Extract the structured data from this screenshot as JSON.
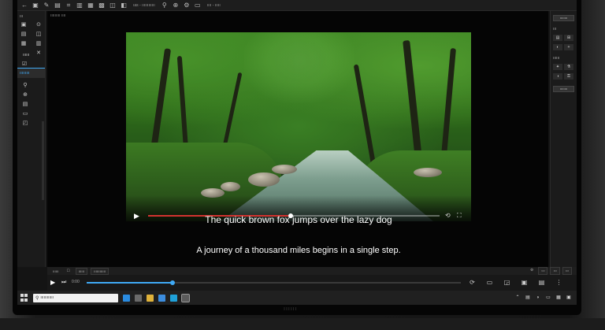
{
  "toolbar": {
    "left_text": "ıas - ıııııııııııı",
    "right_text": "ıııı - ııııı"
  },
  "left_panel": {
    "header": "ııı",
    "tab_a": "ıııııı",
    "tab_b": "ııııııııı"
  },
  "canvas": {
    "header_label": "ııııııııı ıııı"
  },
  "video": {
    "progress": 0.49,
    "progress_color": "#d2332f"
  },
  "captions": {
    "line1": "The quick brown fox jumps over the lazy dog",
    "line2": "A journey of a thousand miles begins in a single step."
  },
  "right_panel": {
    "header1": "ıııııııı",
    "header2": "ııı",
    "header3": "ıııııı",
    "button": "ıııııııı"
  },
  "bottom_tabs": {
    "tab1": "ıııııı",
    "tab2": "ıııııı",
    "tab3": "ıııııııııııı"
  },
  "timeline": {
    "time": "0:00",
    "progress": 0.23,
    "accent_color": "#3fa9f5"
  },
  "taskbar": {
    "search_placeholder": "ıııııııııııı"
  },
  "monitor": {
    "brand": "ıııııı"
  }
}
